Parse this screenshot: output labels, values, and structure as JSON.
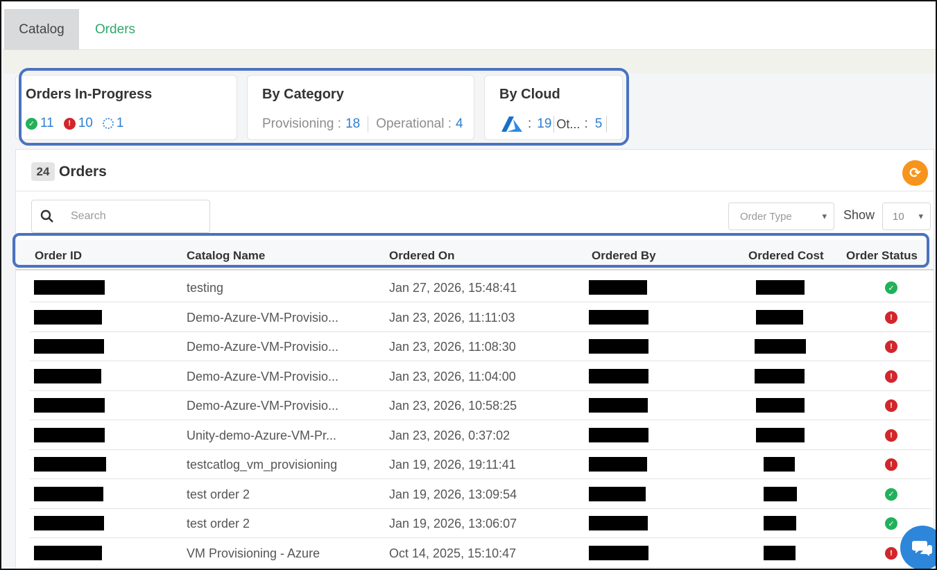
{
  "tabs": [
    {
      "label": "Catalog",
      "active": true
    },
    {
      "label": "Orders",
      "active": false
    }
  ],
  "summary": {
    "in_progress": {
      "title": "Orders In-Progress",
      "success": "11",
      "failed": "10",
      "pending": "1"
    },
    "by_category": {
      "title": "By Category",
      "provisioning_label": "Provisioning :",
      "provisioning_value": "18",
      "operational_label": "Operational :",
      "operational_value": "4"
    },
    "by_cloud": {
      "title": "By Cloud",
      "azure_sep": ":",
      "azure_value": "19",
      "other_label": "Ot...",
      "other_sep": ":",
      "other_value": "5"
    }
  },
  "orders_panel": {
    "count": "24",
    "title": "Orders",
    "search_placeholder": "Search",
    "order_type_placeholder": "Order Type",
    "show_label": "Show",
    "page_size": "10"
  },
  "table": {
    "headers": [
      "Order ID",
      "Catalog Name",
      "Ordered On",
      "Ordered By",
      "Ordered Cost",
      "Order Status"
    ],
    "rows": [
      {
        "catalog": "testing",
        "ordered_on": "Jan 27, 2026, 15:48:41",
        "status": "success"
      },
      {
        "catalog": "Demo-Azure-VM-Provisio...",
        "ordered_on": "Jan 23, 2026, 11:11:03",
        "status": "failed"
      },
      {
        "catalog": "Demo-Azure-VM-Provisio...",
        "ordered_on": "Jan 23, 2026, 11:08:30",
        "status": "failed"
      },
      {
        "catalog": "Demo-Azure-VM-Provisio...",
        "ordered_on": "Jan 23, 2026, 11:04:00",
        "status": "failed"
      },
      {
        "catalog": "Demo-Azure-VM-Provisio...",
        "ordered_on": "Jan 23, 2026, 10:58:25",
        "status": "failed"
      },
      {
        "catalog": "Unity-demo-Azure-VM-Pr...",
        "ordered_on": "Jan 23, 2026, 0:37:02",
        "status": "failed"
      },
      {
        "catalog": "testcatlog_vm_provisioning",
        "ordered_on": "Jan 19, 2026, 19:11:41",
        "status": "failed"
      },
      {
        "catalog": "test order 2",
        "ordered_on": "Jan 19, 2026, 13:09:54",
        "status": "success"
      },
      {
        "catalog": "test order 2",
        "ordered_on": "Jan 19, 2026, 13:06:07",
        "status": "success"
      },
      {
        "catalog": "VM Provisioning - Azure",
        "ordered_on": "Oct 14, 2025, 15:10:47",
        "status": "failed"
      }
    ]
  },
  "colors": {
    "accent_green": "#2fa86a",
    "success": "#21b15a",
    "error": "#d1262b",
    "link_blue": "#2f7fd1",
    "highlight": "#4a72bf",
    "refresh": "#f7941d"
  },
  "icons": {
    "success": "check-circle-icon",
    "failed": "exclamation-circle-icon",
    "pending": "spinner-icon",
    "cloud": "azure-icon",
    "refresh": "refresh-icon",
    "search": "search-icon",
    "chat": "chat-icon"
  }
}
